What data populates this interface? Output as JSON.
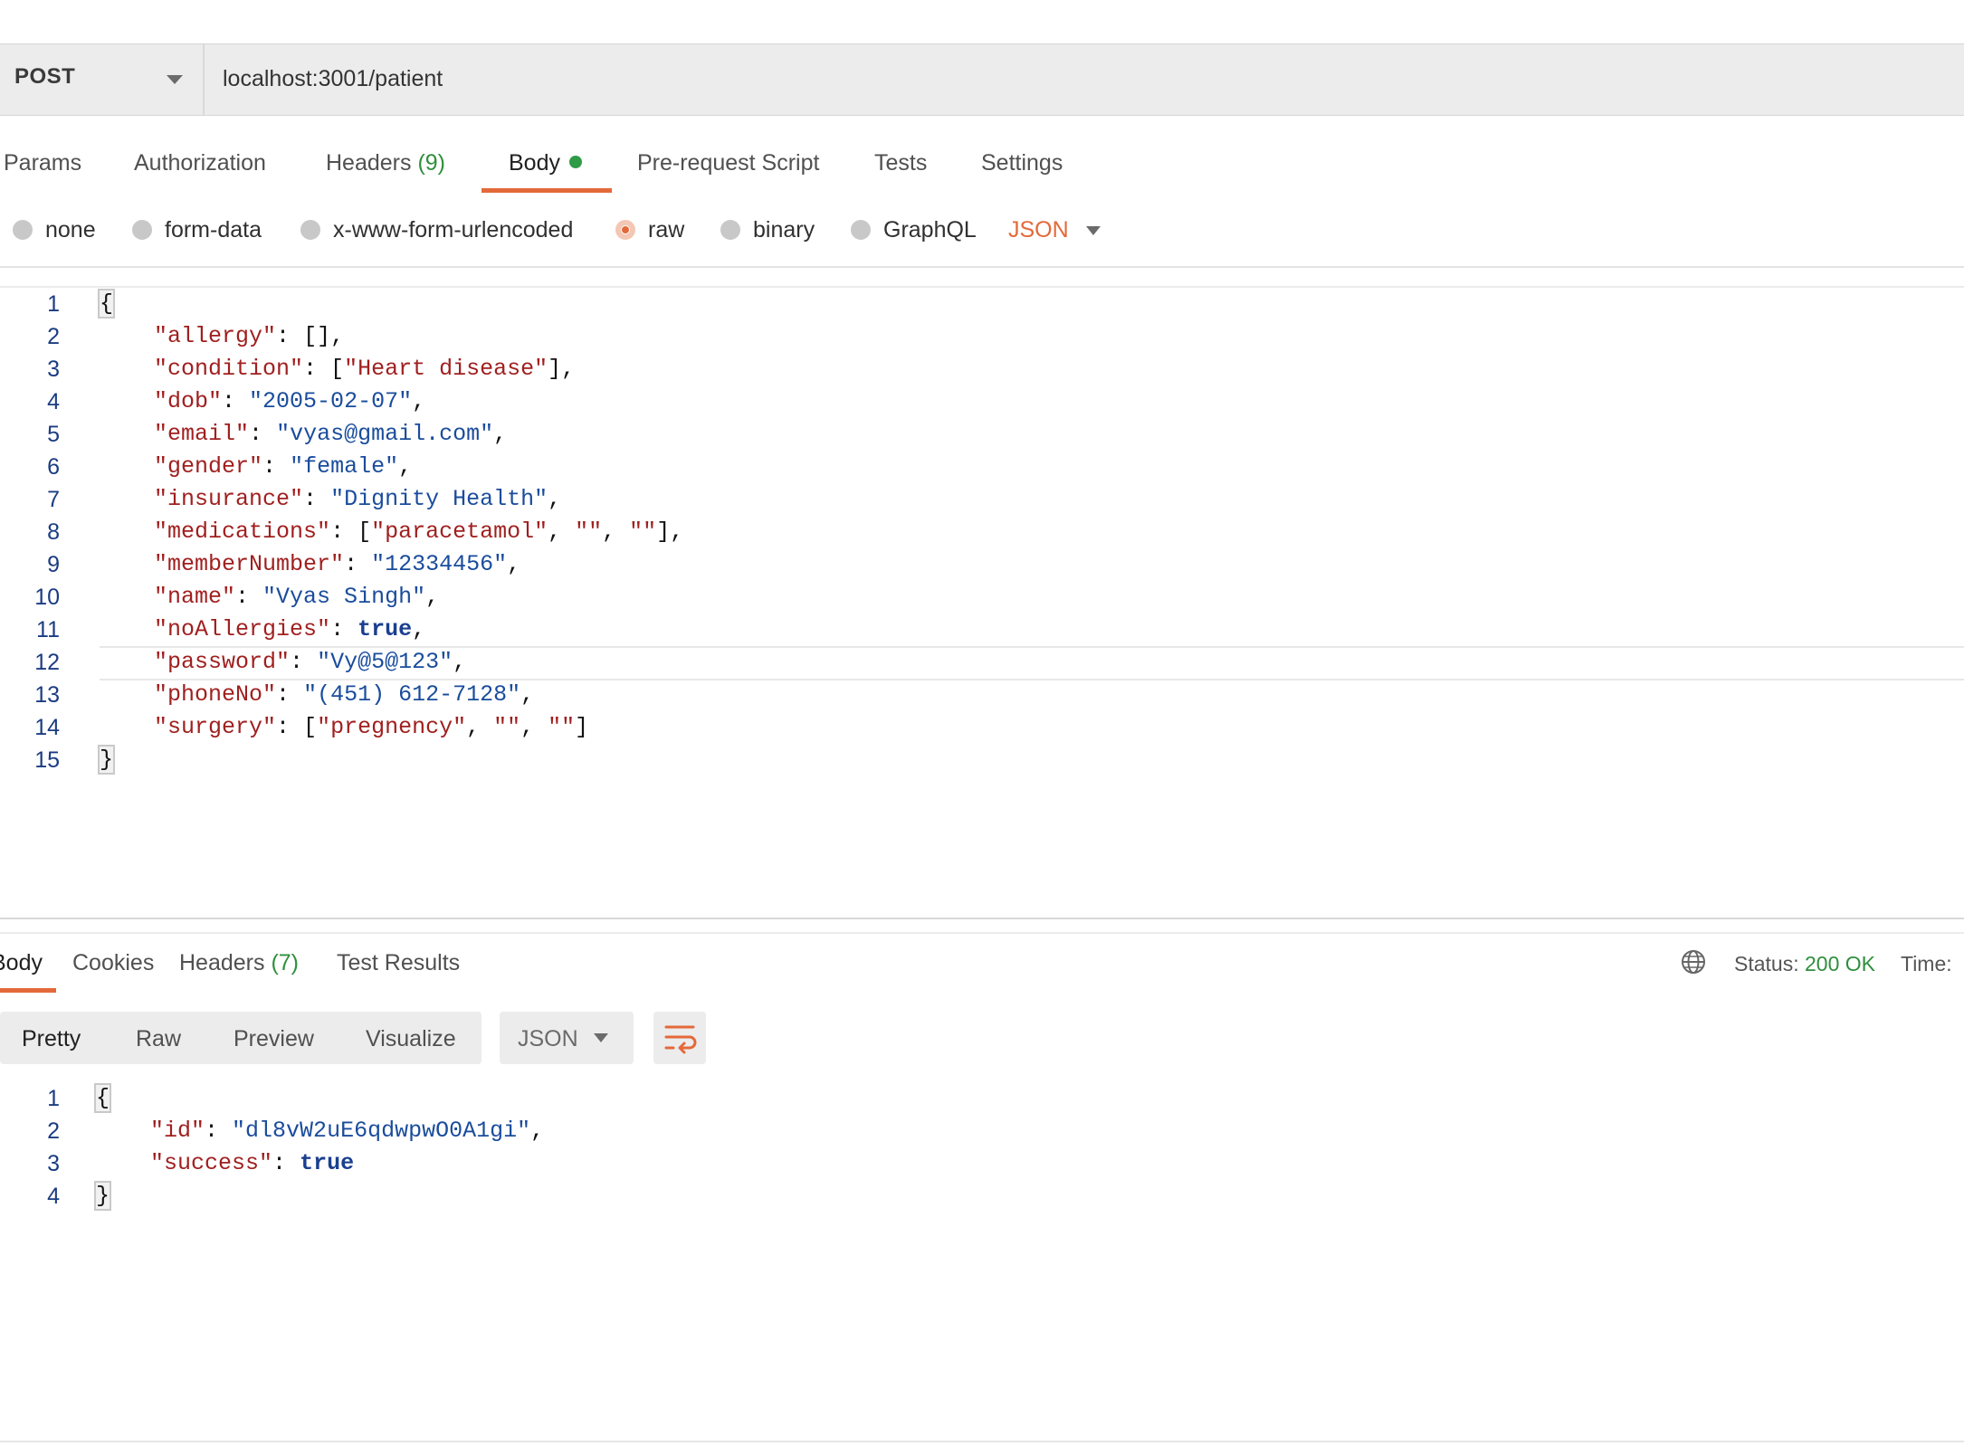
{
  "request": {
    "method": "POST",
    "url": "localhost:3001/patient",
    "tabs": {
      "params": "Params",
      "authorization": "Authorization",
      "headers": "Headers",
      "headers_count": "(9)",
      "body": "Body",
      "prerequest": "Pre-request Script",
      "tests": "Tests",
      "settings": "Settings"
    },
    "active_tab": "Body",
    "body_types": {
      "none": "none",
      "form_data": "form-data",
      "urlencoded": "x-www-form-urlencoded",
      "raw": "raw",
      "binary": "binary",
      "graphql": "GraphQL"
    },
    "selected_body_type": "raw",
    "language": "JSON",
    "line_numbers": [
      "1",
      "2",
      "3",
      "4",
      "5",
      "6",
      "7",
      "8",
      "9",
      "10",
      "11",
      "12",
      "13",
      "14",
      "15"
    ],
    "code": {
      "allergy": {
        "key": "\"allergy\"",
        "value": "[]"
      },
      "condition": {
        "key": "\"condition\"",
        "value": "\"Heart disease\""
      },
      "dob": {
        "key": "\"dob\"",
        "value": "\"2005-02-07\""
      },
      "email": {
        "key": "\"email\"",
        "value": "\"vyas@gmail.com\""
      },
      "gender": {
        "key": "\"gender\"",
        "value": "\"female\""
      },
      "insurance": {
        "key": "\"insurance\"",
        "value": "\"Dignity Health\""
      },
      "medications": {
        "key": "\"medications\"",
        "v1": "\"paracetamol\"",
        "v2": "\"\"",
        "v3": "\"\""
      },
      "memberNumber": {
        "key": "\"memberNumber\"",
        "value": "\"12334456\""
      },
      "name": {
        "key": "\"name\"",
        "value": "\"Vyas Singh\""
      },
      "noAllergies": {
        "key": "\"noAllergies\"",
        "value": "true"
      },
      "password": {
        "key": "\"password\"",
        "value": "\"Vy@5@123\""
      },
      "phoneNo": {
        "key": "\"phoneNo\"",
        "value": "\"(451) 612-7128\""
      },
      "surgery": {
        "key": "\"surgery\"",
        "v1": "\"pregnency\"",
        "v2": "\"\"",
        "v3": "\"\""
      }
    }
  },
  "response": {
    "tabs": {
      "body": "Body",
      "cookies": "Cookies",
      "headers": "Headers",
      "headers_count": "(7)",
      "test_results": "Test Results"
    },
    "status_label": "Status:",
    "status_value": "200 OK",
    "time_label": "Time:",
    "view_modes": {
      "pretty": "Pretty",
      "raw": "Raw",
      "preview": "Preview",
      "visualize": "Visualize"
    },
    "language": "JSON",
    "line_numbers": [
      "1",
      "2",
      "3",
      "4"
    ],
    "code": {
      "id": {
        "key": "\"id\"",
        "value": "\"dl8vW2uE6qdwpwO0A1gi\""
      },
      "success": {
        "key": "\"success\"",
        "value": "true"
      }
    }
  },
  "colors": {
    "accent": "#e4693a",
    "status_ok": "#2f8f3d",
    "json_key": "#a01f1f",
    "json_string": "#1a4c9c"
  },
  "icons": [
    "chevron-down-icon",
    "globe-icon",
    "wrap-lines-icon"
  ]
}
